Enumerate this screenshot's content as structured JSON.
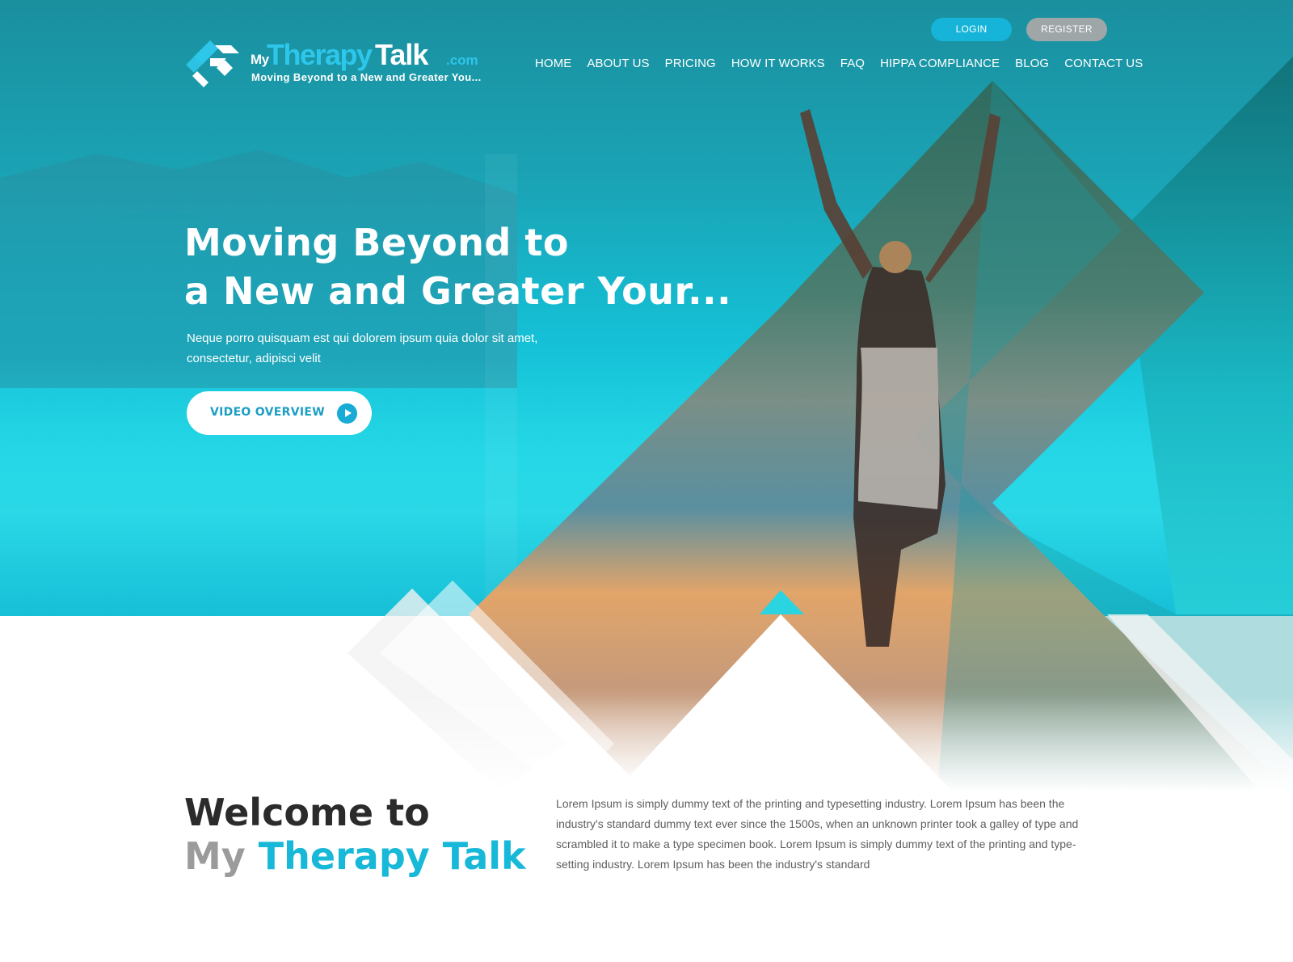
{
  "brand": {
    "logo_my": "My",
    "logo_therapy": "Therapy",
    "logo_talk": "Talk",
    "logo_com": ".com",
    "tagline": "Moving Beyond to a New and Greater You...",
    "colors": {
      "accent": "#17b8d8",
      "register_grey": "#9ea6a8",
      "dark_text": "#2b2b2b"
    }
  },
  "auth": {
    "login_label": "LOGIN",
    "register_label": "REGISTER"
  },
  "nav": {
    "items": [
      {
        "label": "HOME"
      },
      {
        "label": "ABOUT US"
      },
      {
        "label": "PRICING"
      },
      {
        "label": "HOW IT WORKS"
      },
      {
        "label": "FAQ"
      },
      {
        "label": "HIPPA COMPLIANCE"
      },
      {
        "label": "BLOG"
      },
      {
        "label": "CONTACT US"
      }
    ]
  },
  "hero": {
    "title_line1": "Moving Beyond to",
    "title_line2": "a New and Greater Your...",
    "description": "Neque porro quisquam est qui dolorem ipsum quia dolor sit amet, consectetur, adipisci velit",
    "video_button_label": "VIDEO OVERVIEW",
    "video_button_icon": "play-icon"
  },
  "welcome": {
    "line1": "Welcome to",
    "line2_my": "My",
    "line2_brand": "Therapy Talk",
    "body": "Lorem Ipsum is simply dummy text of the printing and typesetting industry. Lorem Ipsum has been the industry's standard dummy text ever since the 1500s, when an unknown printer took a galley of type and scrambled it to make a type specimen book. Lorem Ipsum is simply dummy text of the printing and type-setting industry. Lorem Ipsum has been the industry's standard"
  }
}
